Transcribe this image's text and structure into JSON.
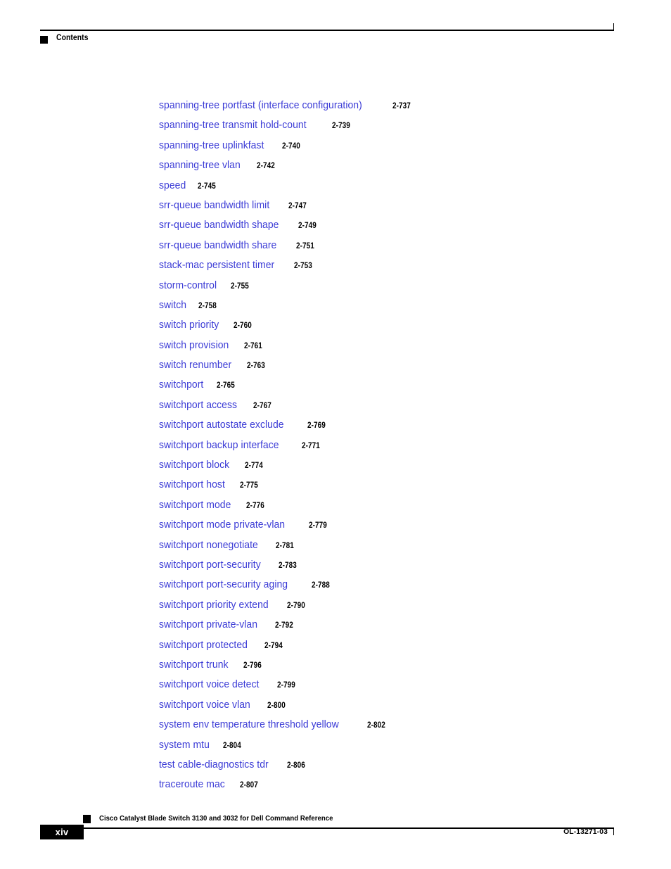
{
  "header": {
    "bullet_icon": "black-square-bullet",
    "title": "Contents"
  },
  "toc": {
    "entries": [
      {
        "label": "spanning-tree portfast (interface configuration)",
        "page": "2-737"
      },
      {
        "label": "spanning-tree transmit hold-count",
        "page": "2-739"
      },
      {
        "label": "spanning-tree uplinkfast",
        "page": "2-740"
      },
      {
        "label": "spanning-tree vlan",
        "page": "2-742"
      },
      {
        "label": "speed",
        "page": "2-745"
      },
      {
        "label": "srr-queue bandwidth limit",
        "page": "2-747"
      },
      {
        "label": "srr-queue bandwidth shape",
        "page": "2-749"
      },
      {
        "label": "srr-queue bandwidth share",
        "page": "2-751"
      },
      {
        "label": "stack-mac persistent timer",
        "page": "2-753"
      },
      {
        "label": "storm-control",
        "page": "2-755"
      },
      {
        "label": "switch",
        "page": "2-758"
      },
      {
        "label": "switch priority",
        "page": "2-760"
      },
      {
        "label": "switch provision",
        "page": "2-761"
      },
      {
        "label": "switch renumber",
        "page": "2-763"
      },
      {
        "label": "switchport",
        "page": "2-765"
      },
      {
        "label": "switchport access",
        "page": "2-767"
      },
      {
        "label": "switchport autostate exclude",
        "page": "2-769"
      },
      {
        "label": "switchport backup interface",
        "page": "2-771"
      },
      {
        "label": "switchport block",
        "page": "2-774"
      },
      {
        "label": "switchport host",
        "page": "2-775"
      },
      {
        "label": "switchport mode",
        "page": "2-776"
      },
      {
        "label": "switchport mode private-vlan",
        "page": "2-779"
      },
      {
        "label": "switchport nonegotiate",
        "page": "2-781"
      },
      {
        "label": "switchport port-security",
        "page": "2-783"
      },
      {
        "label": "switchport port-security aging",
        "page": "2-788"
      },
      {
        "label": "switchport priority extend",
        "page": "2-790"
      },
      {
        "label": "switchport private-vlan",
        "page": "2-792"
      },
      {
        "label": "switchport protected",
        "page": "2-794"
      },
      {
        "label": "switchport trunk",
        "page": "2-796"
      },
      {
        "label": "switchport voice detect",
        "page": "2-799"
      },
      {
        "label": "switchport voice vlan",
        "page": "2-800"
      },
      {
        "label": "system env temperature threshold yellow",
        "page": "2-802"
      },
      {
        "label": "system mtu",
        "page": "2-804"
      },
      {
        "label": "test cable-diagnostics tdr",
        "page": "2-806"
      },
      {
        "label": "traceroute mac",
        "page": "2-807"
      }
    ]
  },
  "footer": {
    "doc_title": "Cisco Catalyst Blade Switch 3130 and 3032 for Dell Command Reference",
    "page_number": "xiv",
    "doc_id": "OL-13271-03",
    "square_icon": "black-square-bullet"
  },
  "colors": {
    "link_blue": "#3b3bd6",
    "rule_black": "#000000",
    "page_bg": "#ffffff"
  }
}
